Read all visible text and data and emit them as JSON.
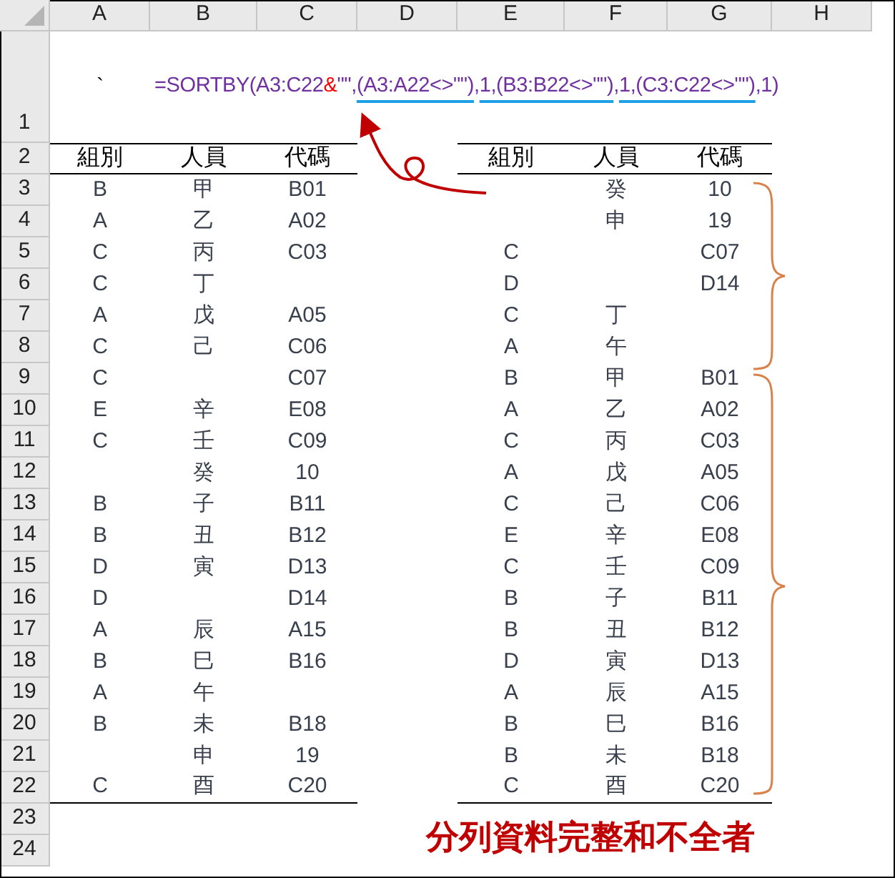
{
  "columns": [
    "A",
    "B",
    "C",
    "D",
    "E",
    "F",
    "G",
    "H"
  ],
  "row_numbers": [
    "1",
    "2",
    "3",
    "4",
    "5",
    "6",
    "7",
    "8",
    "9",
    "10",
    "11",
    "12",
    "13",
    "14",
    "15",
    "16",
    "17",
    "18",
    "19",
    "20",
    "21",
    "22",
    "23",
    "24"
  ],
  "cell_a1": "`",
  "formula": [
    {
      "kind": "plain",
      "text": "=SORTBY(A3:C22"
    },
    {
      "kind": "highlight",
      "text": "&"
    },
    {
      "kind": "plain",
      "text": "\"\","
    },
    {
      "kind": "underline",
      "text": "(A3:A22<>\"\")"
    },
    {
      "kind": "plain",
      "text": ","
    },
    {
      "kind": "underline",
      "text": "1,(B3:B22<>\"\")"
    },
    {
      "kind": "plain",
      "text": ","
    },
    {
      "kind": "underline",
      "text": "1,(C3:C22<>\"\")"
    },
    {
      "kind": "plain",
      "text": ",1)"
    }
  ],
  "left_table": {
    "headers": [
      "組別",
      "人員",
      "代碼"
    ],
    "rows": [
      {
        "group": "B",
        "person": "甲",
        "code": "B01"
      },
      {
        "group": "A",
        "person": "乙",
        "code": "A02"
      },
      {
        "group": "C",
        "person": "丙",
        "code": "C03"
      },
      {
        "group": "C",
        "person": "丁"
      },
      {
        "group": "A",
        "person": "戊",
        "code": "A05"
      },
      {
        "group": "C",
        "person": "己",
        "code": "C06"
      },
      {
        "group": "C",
        "code": "C07"
      },
      {
        "group": "E",
        "person": "辛",
        "code": "E08"
      },
      {
        "group": "C",
        "person": "壬",
        "code": "C09"
      },
      {
        "person": "癸",
        "code": "10"
      },
      {
        "group": "B",
        "person": "子",
        "code": "B11"
      },
      {
        "group": "B",
        "person": "丑",
        "code": "B12"
      },
      {
        "group": "D",
        "person": "寅",
        "code": "D13"
      },
      {
        "group": "D",
        "code": "D14"
      },
      {
        "group": "A",
        "person": "辰",
        "code": "A15"
      },
      {
        "group": "B",
        "person": "巳",
        "code": "B16"
      },
      {
        "group": "A",
        "person": "午"
      },
      {
        "group": "B",
        "person": "未",
        "code": "B18"
      },
      {
        "person": "申",
        "code": "19"
      },
      {
        "group": "C",
        "person": "酉",
        "code": "C20"
      }
    ]
  },
  "right_table": {
    "headers": [
      "組別",
      "人員",
      "代碼"
    ],
    "rows": [
      {
        "person": "癸",
        "code": "10"
      },
      {
        "person": "申",
        "code": "19"
      },
      {
        "group": "C",
        "code": "C07"
      },
      {
        "group": "D",
        "code": "D14"
      },
      {
        "group": "C",
        "person": "丁"
      },
      {
        "group": "A",
        "person": "午"
      },
      {
        "group": "B",
        "person": "甲",
        "code": "B01"
      },
      {
        "group": "A",
        "person": "乙",
        "code": "A02"
      },
      {
        "group": "C",
        "person": "丙",
        "code": "C03"
      },
      {
        "group": "A",
        "person": "戊",
        "code": "A05"
      },
      {
        "group": "C",
        "person": "己",
        "code": "C06"
      },
      {
        "group": "E",
        "person": "辛",
        "code": "E08"
      },
      {
        "group": "C",
        "person": "壬",
        "code": "C09"
      },
      {
        "group": "B",
        "person": "子",
        "code": "B11"
      },
      {
        "group": "B",
        "person": "丑",
        "code": "B12"
      },
      {
        "group": "D",
        "person": "寅",
        "code": "D13"
      },
      {
        "group": "A",
        "person": "辰",
        "code": "A15"
      },
      {
        "group": "B",
        "person": "巳",
        "code": "B16"
      },
      {
        "group": "B",
        "person": "未",
        "code": "B18"
      },
      {
        "group": "C",
        "person": "酉",
        "code": "C20"
      }
    ]
  },
  "caption": "分列資料完整和不全者"
}
